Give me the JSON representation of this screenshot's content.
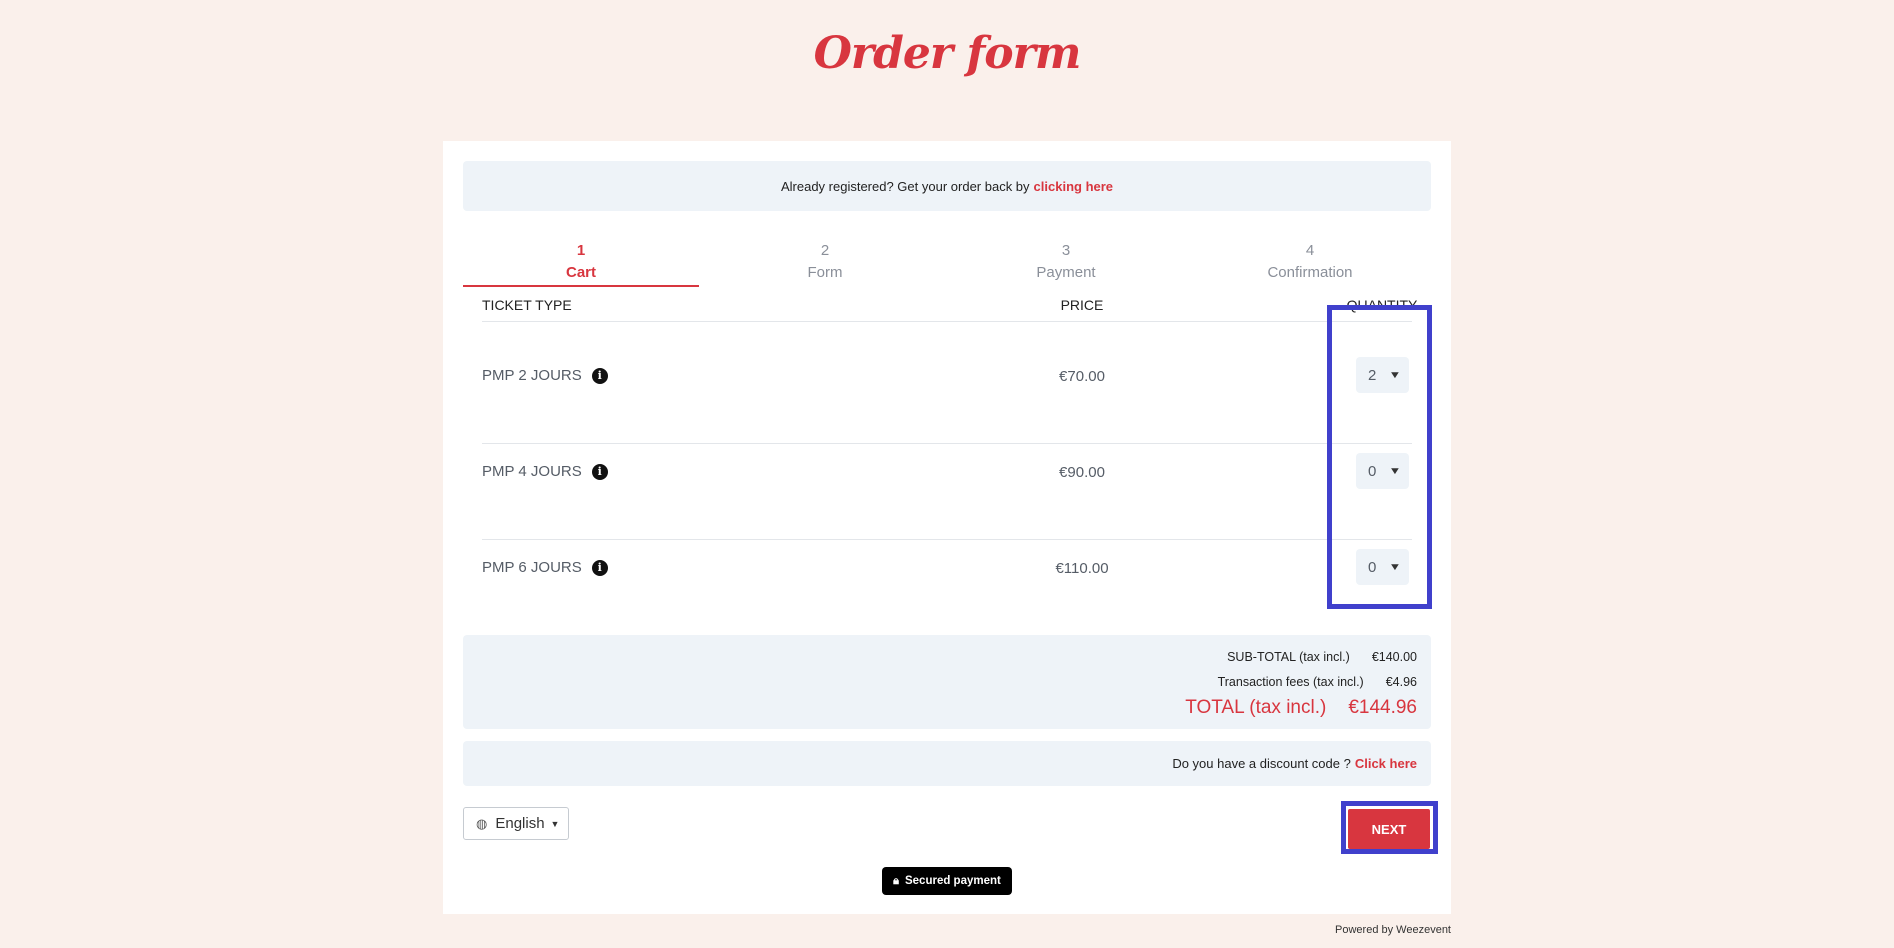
{
  "page": {
    "title": "Order form"
  },
  "notice": {
    "text": "Already registered? Get your order back by",
    "link": "clicking here"
  },
  "steps": [
    {
      "num": "1",
      "label": "Cart",
      "active": true
    },
    {
      "num": "2",
      "label": "Form"
    },
    {
      "num": "3",
      "label": "Payment"
    },
    {
      "num": "4",
      "label": "Confirmation"
    }
  ],
  "table": {
    "headers": {
      "ticket_type": "TICKET TYPE",
      "price": "PRICE",
      "quantity": "QUANTITY"
    },
    "rows": [
      {
        "name": "PMP 2 JOURS",
        "price": "€70.00",
        "quantity": "2"
      },
      {
        "name": "PMP 4 JOURS",
        "price": "€90.00",
        "quantity": "0"
      },
      {
        "name": "PMP 6 JOURS",
        "price": "€110.00",
        "quantity": "0"
      }
    ]
  },
  "totals": {
    "subtotal_label": "SUB-TOTAL (tax incl.)",
    "subtotal_value": "€140.00",
    "fees_label": "Transaction fees (tax incl.)",
    "fees_value": "€4.96",
    "total_label": "TOTAL (tax incl.)",
    "total_value": "€144.96"
  },
  "discount": {
    "text": "Do you have a discount code ?",
    "link": "Click here"
  },
  "language": {
    "selected": "English"
  },
  "next_label": "NEXT",
  "secured_label": "Secured payment",
  "footer": {
    "powered": "Powered by Weezevent"
  },
  "colors": {
    "accent": "#d8363f",
    "background": "#faf0eb",
    "panel": "#eef3f8",
    "highlight": "#4040cc"
  },
  "icons": {
    "info": "info-icon",
    "globe": "globe-icon",
    "lock": "lock-icon",
    "chevron": "chevron-down-icon"
  }
}
